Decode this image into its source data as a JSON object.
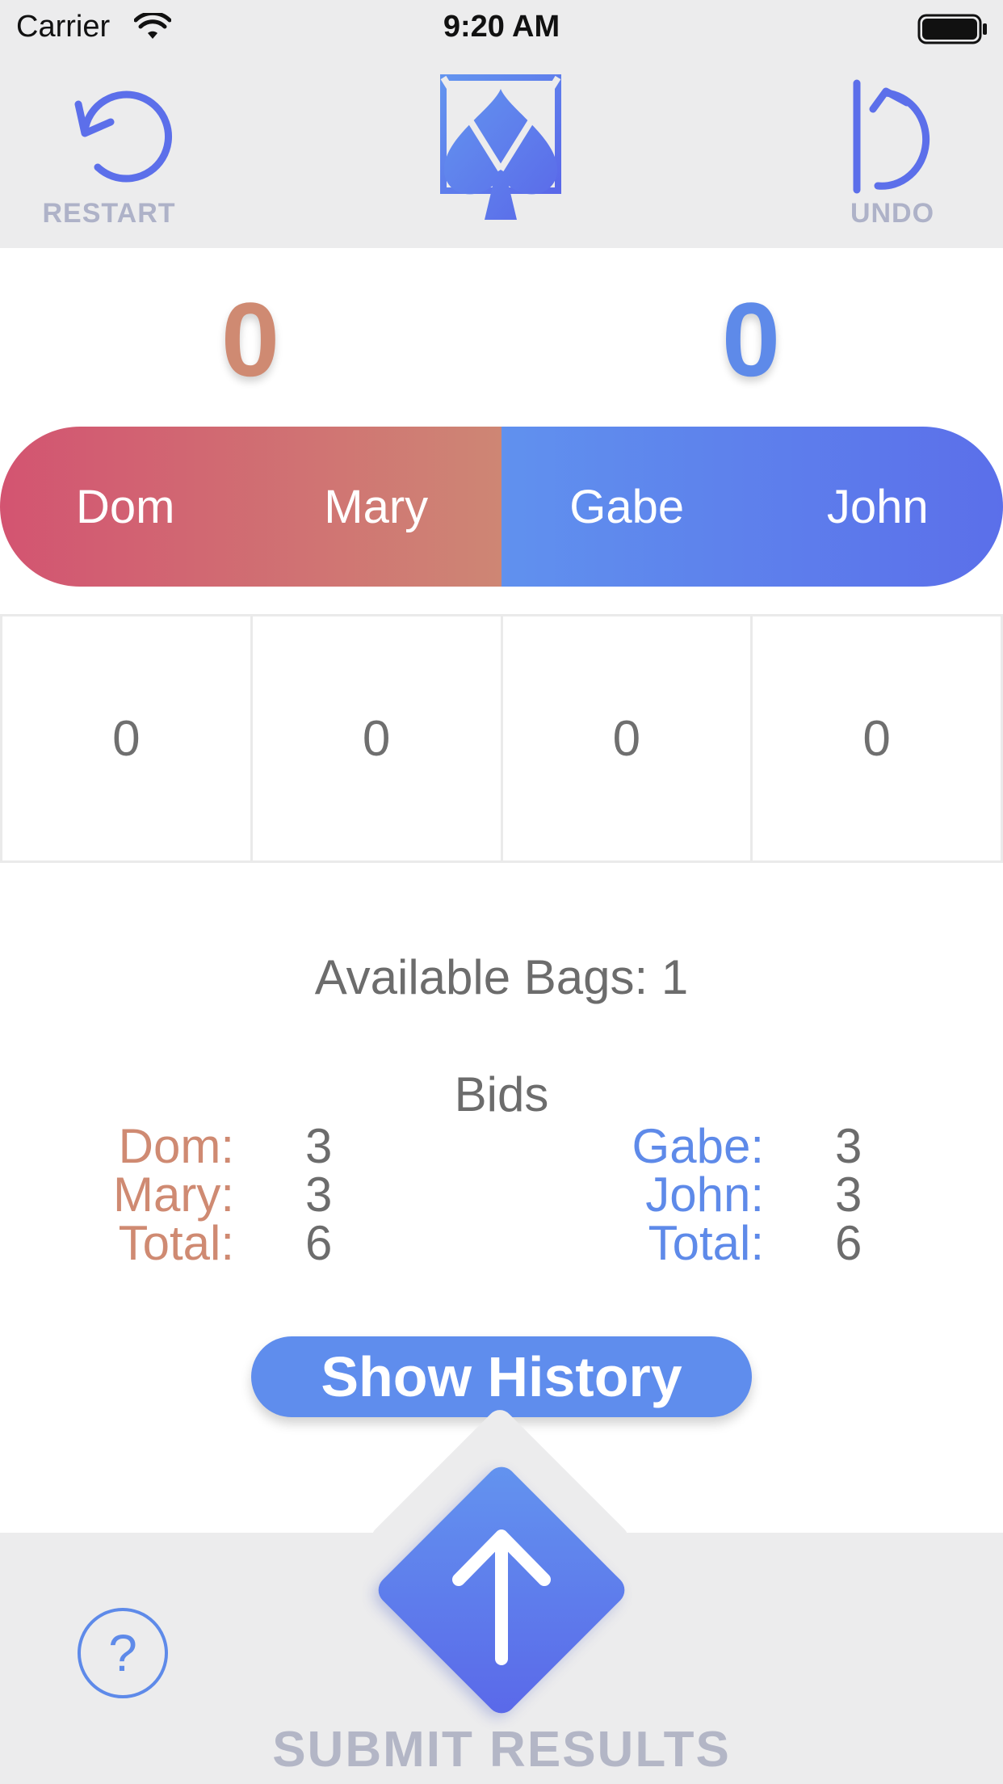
{
  "status_bar": {
    "carrier": "Carrier",
    "time": "9:20 AM"
  },
  "header": {
    "restart_label": "RESTART",
    "undo_label": "UNDO",
    "logo_icon": "spade-card-icon"
  },
  "scores": {
    "left": "0",
    "right": "0"
  },
  "colors": {
    "left_team": "#cf8a72",
    "right_team": "#5e8ae9"
  },
  "teams": {
    "left": {
      "players": [
        "Dom",
        "Mary"
      ]
    },
    "right": {
      "players": [
        "Gabe",
        "John"
      ]
    }
  },
  "tricks": [
    "0",
    "0",
    "0",
    "0"
  ],
  "available_bags": "Available Bags: 1",
  "bids": {
    "title": "Bids",
    "left": [
      {
        "label": "Dom:",
        "value": "3"
      },
      {
        "label": "Mary:",
        "value": "3"
      },
      {
        "label": "Total:",
        "value": "6"
      }
    ],
    "right": [
      {
        "label": "Gabe:",
        "value": "3"
      },
      {
        "label": "John:",
        "value": "3"
      },
      {
        "label": "Total:",
        "value": "6"
      }
    ]
  },
  "show_history_label": "Show History",
  "submit_label": "SUBMIT RESULTS",
  "help_label": "?"
}
